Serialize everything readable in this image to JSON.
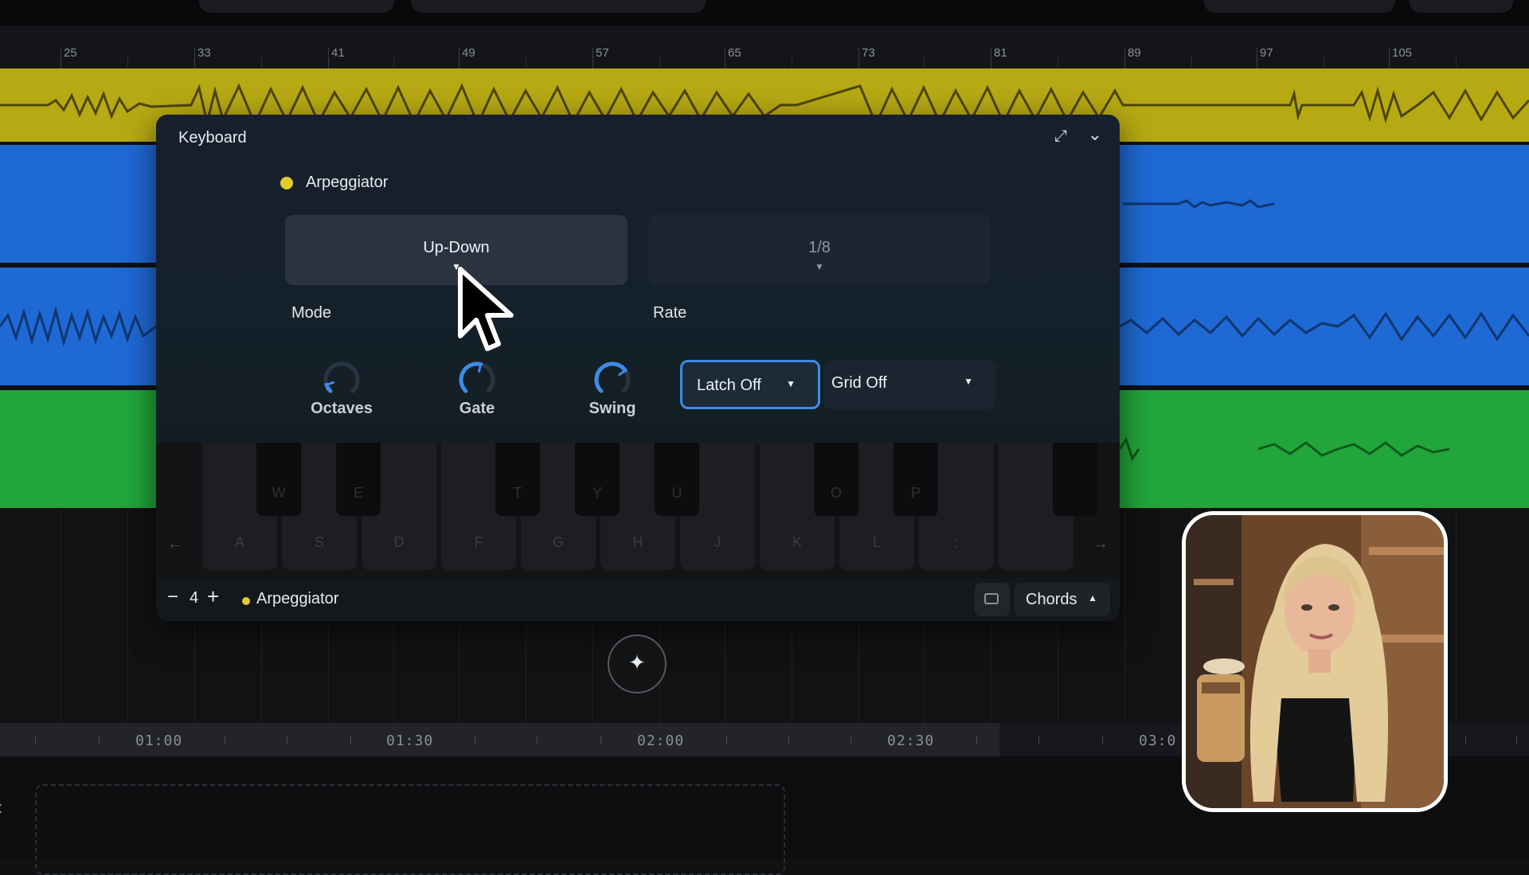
{
  "ruler": {
    "bars": [
      "25",
      "33",
      "41",
      "49",
      "57",
      "65",
      "73",
      "81",
      "89",
      "97",
      "105"
    ]
  },
  "tracks": [
    {
      "name": "yellow-track",
      "color": "#b7a914"
    },
    {
      "name": "blue-track-1",
      "color": "#1f69d4"
    },
    {
      "name": "blue-track-2",
      "color": "#1f69d4"
    },
    {
      "name": "green-track",
      "color": "#22a63a"
    }
  ],
  "keyboard": {
    "title": "Keyboard",
    "arpeggiator_label": "Arpeggiator",
    "mode": {
      "value": "Up-Down",
      "label": "Mode"
    },
    "rate": {
      "value": "1/8",
      "label": "Rate"
    },
    "knobs": [
      {
        "label": "Octaves",
        "value": 0.1
      },
      {
        "label": "Gate",
        "value": 0.55
      },
      {
        "label": "Swing",
        "value": 0.7
      }
    ],
    "latch": "Latch Off",
    "grid": "Grid Off",
    "keys": [
      "A",
      "S",
      "D",
      "F",
      "G",
      "H",
      "J",
      "K",
      "L",
      ";"
    ],
    "black_keys": [
      "W",
      "E",
      "T",
      "Y",
      "U",
      "O",
      "P"
    ],
    "footer": {
      "octave": "4",
      "minus": "−",
      "plus": "+",
      "arpeggiator": "Arpeggiator",
      "chords": "Chords"
    },
    "accent": "#3d8be6",
    "arp_color": "#e2cb2c"
  },
  "timeline": {
    "times": [
      "01:00",
      "01:30",
      "02:00",
      "02:30",
      "03:0"
    ]
  },
  "icons": {
    "expand": "expand-icon",
    "collapse": "chevron-down-icon",
    "left_arrow": "arrow-left-icon",
    "right_arrow": "arrow-right-icon",
    "keyboard": "keyboard-icon",
    "sparkle": "sparkle-icon",
    "cursor": "cursor-icon"
  }
}
